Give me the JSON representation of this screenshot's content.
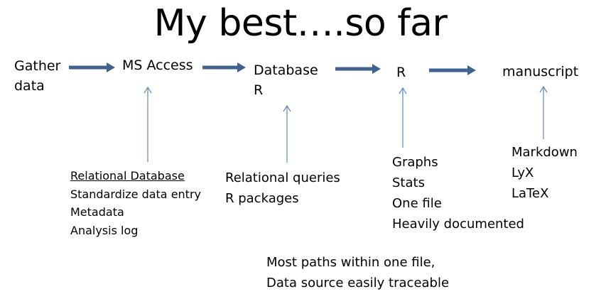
{
  "title": "My best….so far",
  "colors": {
    "flow_arrow": "#3f628e",
    "annotation_arrow": "#5b87b8",
    "text": "#000000",
    "background": "#ffffff"
  },
  "stages": [
    {
      "id": "gather",
      "lines": [
        "Gather",
        "data"
      ]
    },
    {
      "id": "ms-access",
      "lines": [
        "MS Access"
      ]
    },
    {
      "id": "database-r",
      "lines": [
        "Database",
        "R"
      ]
    },
    {
      "id": "r",
      "lines": [
        "R"
      ]
    },
    {
      "id": "manuscript",
      "lines": [
        "manuscript"
      ]
    }
  ],
  "notes": {
    "ms_access": [
      "Relational Database",
      "Standardize data entry",
      "Metadata",
      "Analysis log"
    ],
    "database_r": [
      "Relational queries",
      "R packages"
    ],
    "r": [
      "Graphs",
      "Stats",
      "One file",
      "Heavily documented"
    ],
    "manuscript": [
      "Markdown",
      "LyX",
      "LaTeX"
    ]
  },
  "footer": [
    "Most paths within one file,",
    "Data source easily traceable"
  ]
}
